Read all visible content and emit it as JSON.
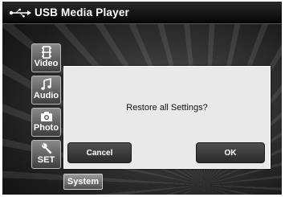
{
  "titlebar": {
    "title": "USB Media Player",
    "icon": "usb-icon"
  },
  "tabs": [
    {
      "label": "Video",
      "icon": "film-icon"
    },
    {
      "label": "Audio",
      "icon": "music-note-icon"
    },
    {
      "label": "Photo",
      "icon": "camera-icon"
    },
    {
      "label": "SET",
      "icon": "wrench-icon"
    }
  ],
  "system_tab": {
    "label": "System"
  },
  "dialog": {
    "message": "Restore all Settings?",
    "cancel_label": "Cancel",
    "ok_label": "OK"
  },
  "colors": {
    "titlebar": "#050505",
    "dialog_bg": "#e9e9e9",
    "button": "#3a3a3a"
  }
}
